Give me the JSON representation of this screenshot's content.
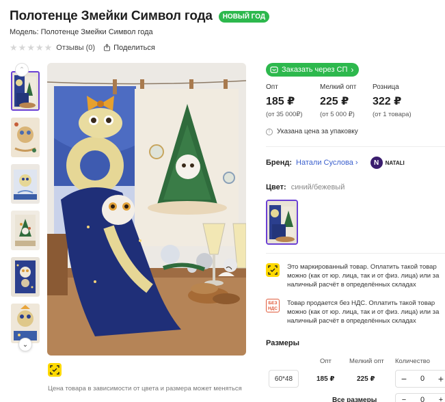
{
  "header": {
    "title": "Полотенце Змейки Символ года",
    "badge": "НОВЫЙ ГОД",
    "model": "Модель: Полотенце Змейки Символ года",
    "reviews": "Отзывы (0)",
    "share": "Поделиться",
    "rating": 0
  },
  "purchase": {
    "sp_button": "Заказать через СП",
    "prices": [
      {
        "label": "Опт",
        "value": "185 ₽",
        "sub": "(от 35 000₽)"
      },
      {
        "label": "Мелкий опт",
        "value": "225 ₽",
        "sub": "(от 5 000 ₽)"
      },
      {
        "label": "Розница",
        "value": "322 ₽",
        "sub": "(от 1 товара)"
      }
    ],
    "pack_note": "Указана цена за упаковку"
  },
  "brand": {
    "label": "Бренд:",
    "name": "Натали Суслова",
    "logo_text": "NATALI",
    "logo_letter": "N"
  },
  "color": {
    "label": "Цвет:",
    "value": "синий/бежевый"
  },
  "notices": {
    "marked": "Это маркированный товар. Оплатить такой товар можно (как от юр. лица, так и от физ. лица) или за наличный расчёт в определённых складах",
    "no_vat": "Товар продается без НДС. Оплатить такой товар можно (как от юр. лица, так и от физ. лица) или за наличный расчёт в определённых складах",
    "no_vat_icon": "БЕЗ НДС"
  },
  "sizes": {
    "title": "Размеры",
    "headers": {
      "opt": "Опт",
      "small_opt": "Мелкий опт",
      "qty": "Количество"
    },
    "rows": [
      {
        "size": "60*48",
        "opt": "185 ₽",
        "small_opt": "225 ₽",
        "qty": "0"
      }
    ],
    "all_sizes": "Все размеры",
    "all_qty": "0"
  },
  "gallery": {
    "price_note": "Цена товара в зависимости от цвета и размера может меняться",
    "thumb_count": 6,
    "active_thumb": 0
  },
  "colors": {
    "accent_green": "#2db84d",
    "accent_purple": "#6a3fd4",
    "link_blue": "#3a5fcd",
    "marked_yellow": "#ffd900",
    "vat_red": "#e05a3a"
  }
}
